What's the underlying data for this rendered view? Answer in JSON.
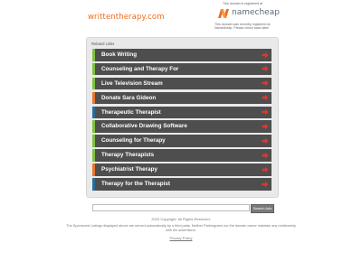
{
  "header": {
    "domain": "writtentherapy.com",
    "registered_note_top": "This domain is registered at",
    "registrar_name": "namecheap",
    "registered_note": "This domain was recently registered at Namecheap. Please check back later!"
  },
  "related": {
    "title": "Related Links",
    "items": [
      {
        "label": "Book Writing",
        "accent": "#7fc141"
      },
      {
        "label": "Counseling and Therapy For",
        "accent": "#7fc141"
      },
      {
        "label": "Live Television Stream",
        "accent": "#7fc141"
      },
      {
        "label": "Donate Sara Gideon",
        "accent": "#e8762d"
      },
      {
        "label": "Therapeutic Therapist",
        "accent": "#2a6d9a"
      },
      {
        "label": "Collaborative Drawing Software",
        "accent": "#7fc141"
      },
      {
        "label": "Counseling for Therapy",
        "accent": "#7fc141"
      },
      {
        "label": "Therapy Therapists",
        "accent": "#7fc141"
      },
      {
        "label": "Psychiatrist Therapy",
        "accent": "#e8762d"
      },
      {
        "label": "Therapy for the Therapist",
        "accent": "#2a6d9a"
      }
    ]
  },
  "search": {
    "input_value": "",
    "button_label": "Search Ads"
  },
  "footer": {
    "copyright": "2020 Copyright. All Rights Reserved.",
    "disclaimer": "The Sponsored Listings displayed above are served automatically by a third party. Neither Parkingcrew nor the domain owner maintain any relationship with the advertisers.",
    "privacy": "Privacy Policy"
  },
  "colors": {
    "arrow": "#e3352c",
    "row_bg": "#4e4e4e",
    "brand_orange": "#ef6c1c"
  }
}
